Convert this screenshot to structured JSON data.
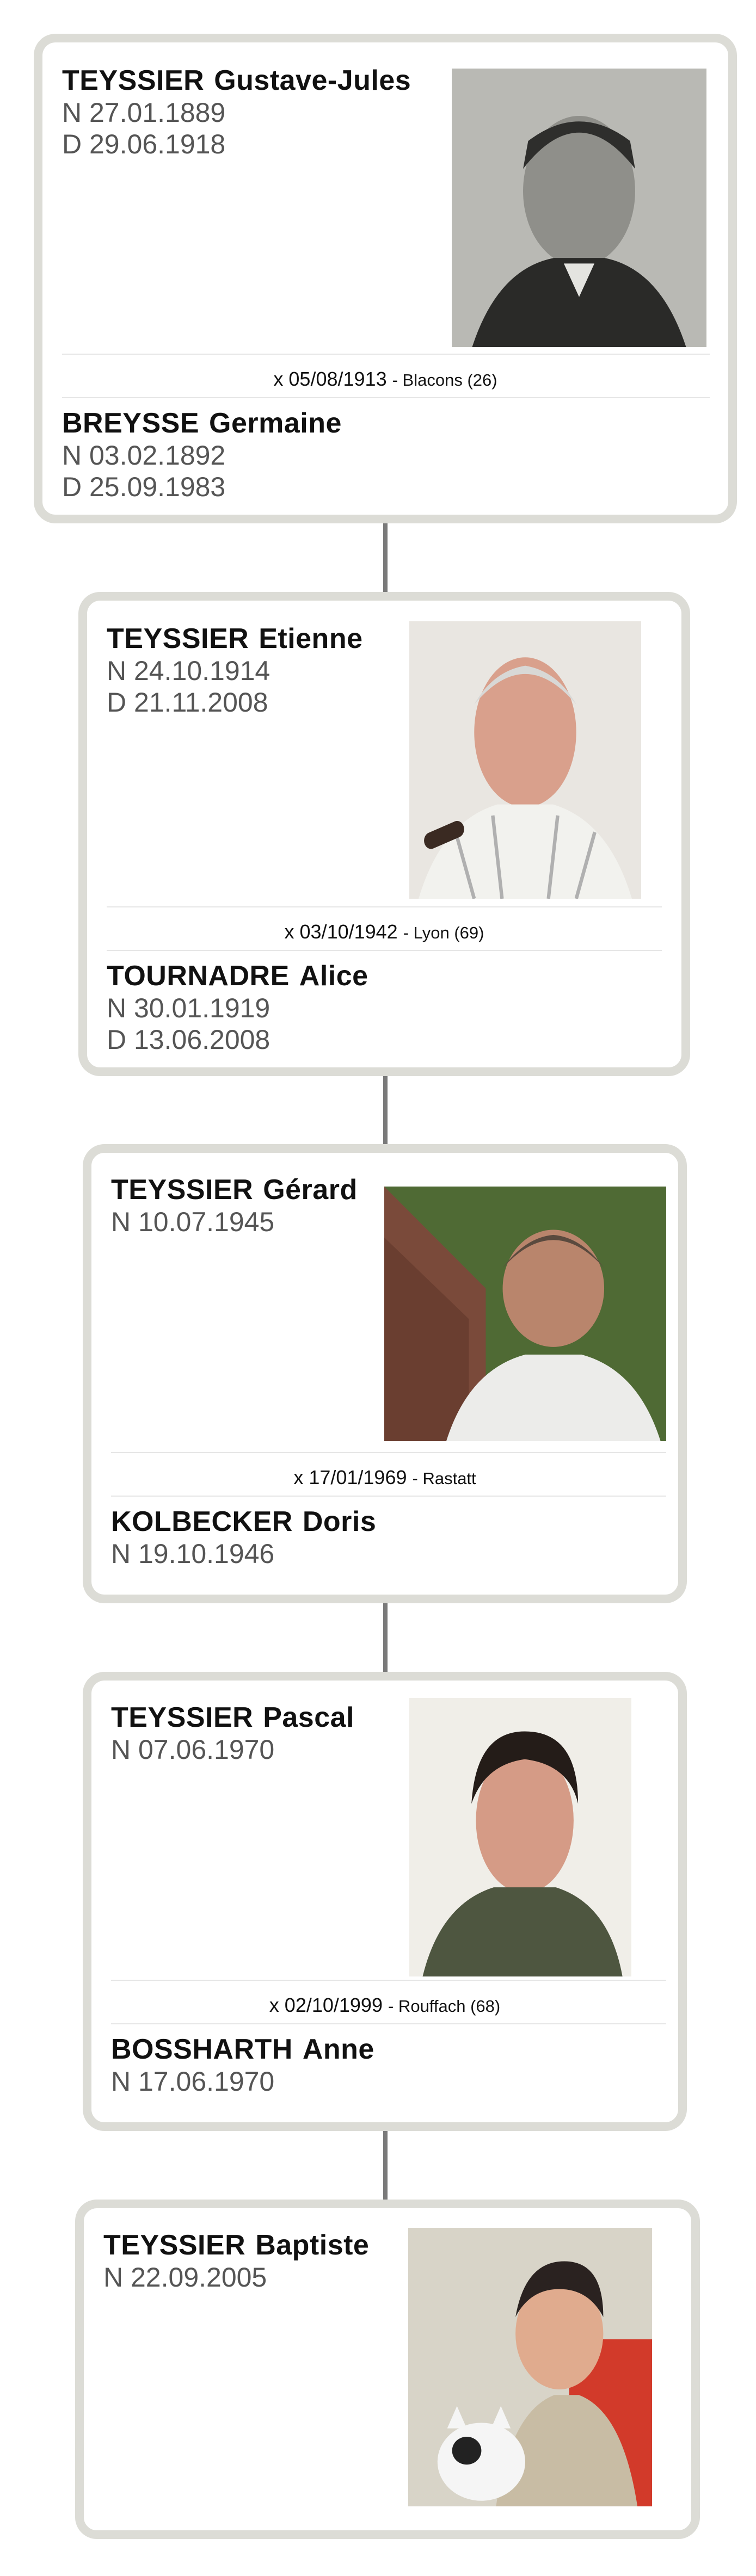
{
  "generations": [
    {
      "husband": {
        "surname": "TEYSSIER",
        "given": "Gustave-Jules",
        "birth": "N 27.01.1889",
        "death": "D 29.06.1918"
      },
      "photo": "portrait-photo",
      "marriage": {
        "date": "x 05/08/1913",
        "place": "- Blacons (26)"
      },
      "wife": {
        "surname": "BREYSSE",
        "given": "Germaine",
        "birth": "N 03.02.1892",
        "death": "D 25.09.1983"
      }
    },
    {
      "husband": {
        "surname": "TEYSSIER",
        "given": "Etienne",
        "birth": "N 24.10.1914",
        "death": "D 21.11.2008"
      },
      "photo": "portrait-photo",
      "marriage": {
        "date": "x 03/10/1942",
        "place": "- Lyon (69)"
      },
      "wife": {
        "surname": "TOURNADRE",
        "given": "Alice",
        "birth": "N 30.01.1919",
        "death": "D 13.06.2008"
      }
    },
    {
      "husband": {
        "surname": "TEYSSIER",
        "given": "Gérard",
        "birth": "N 10.07.1945"
      },
      "photo": "portrait-photo",
      "marriage": {
        "date": "x 17/01/1969",
        "place": "- Rastatt"
      },
      "wife": {
        "surname": "KOLBECKER",
        "given": "Doris",
        "birth": "N 19.10.1946"
      }
    },
    {
      "husband": {
        "surname": "TEYSSIER",
        "given": "Pascal",
        "birth": "N 07.06.1970"
      },
      "photo": "portrait-photo",
      "marriage": {
        "date": "x 02/10/1999",
        "place": "- Rouffach (68)"
      },
      "wife": {
        "surname": "BOSSHARTH",
        "given": "Anne",
        "birth": "N 17.06.1970"
      }
    },
    {
      "husband": {
        "surname": "TEYSSIER",
        "given": "Baptiste",
        "birth": "N 22.09.2005"
      },
      "photo": "portrait-photo"
    }
  ],
  "colors": {
    "card_border": "#dcdcd6",
    "connector": "#7a7a7a",
    "name": "#111111",
    "date": "#555555"
  }
}
